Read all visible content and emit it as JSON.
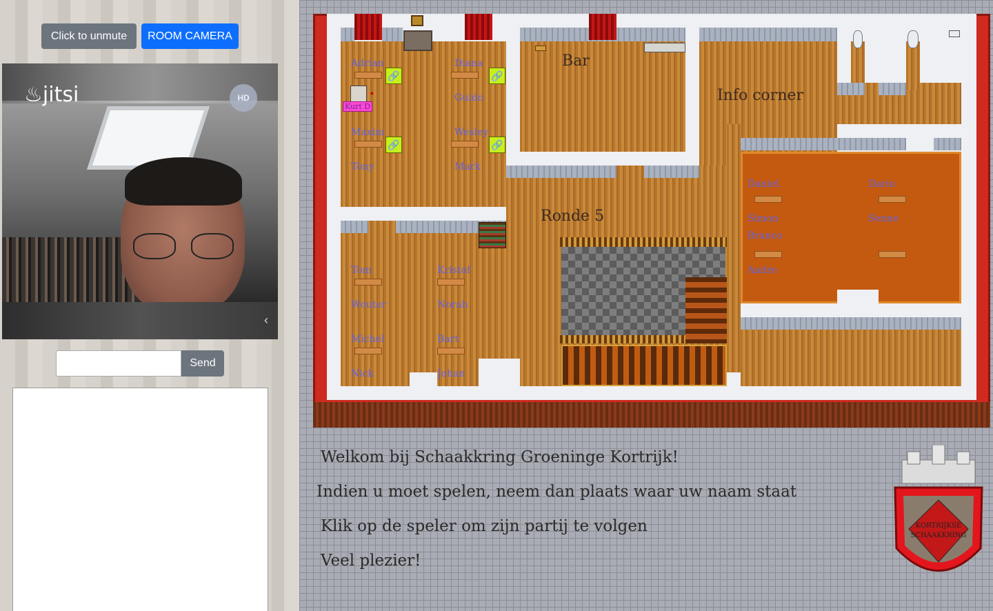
{
  "controls": {
    "unmute_label": "Click to unmute",
    "room_camera_label": "ROOM CAMERA"
  },
  "video": {
    "brand": "jitsi",
    "quality_badge": "HD",
    "collapse_icon": "chevron-left-icon"
  },
  "chat": {
    "input_value": "",
    "send_label": "Send"
  },
  "map": {
    "rooms": {
      "bar": "Bar",
      "info_corner": "Info corner",
      "round": "Ronde 5"
    },
    "players_top_left": [
      "Adrian",
      "Diana",
      "Guido",
      "Maxim",
      "Wesley",
      "Tony",
      "Mark"
    ],
    "players_bottom_left": [
      "Tom",
      "Kristof",
      "Wouter",
      "Norah",
      "Michel",
      "Bart",
      "Nick",
      "Johan"
    ],
    "players_right_room": [
      "Daniel",
      "Dario",
      "Simon",
      "Senne",
      "Branco",
      "Andre"
    ],
    "avatar": {
      "name": "Kurt D"
    }
  },
  "welcome": {
    "line1": "Welkom bij Schaakkring Groeninge Kortrijk!",
    "line2": "Indien u moet spelen, neem dan plaats waar uw naam staat",
    "line3": "Klik op de speler om zijn partij te volgen",
    "line4": "Veel plezier!"
  },
  "crest": {
    "text": "KORTRIJKSE SCHAAKKRING"
  },
  "colors": {
    "primary": "#0d6efd",
    "secondary": "#6c757d",
    "map_frame": "#cf2a20",
    "name_text": "#6262e0"
  }
}
